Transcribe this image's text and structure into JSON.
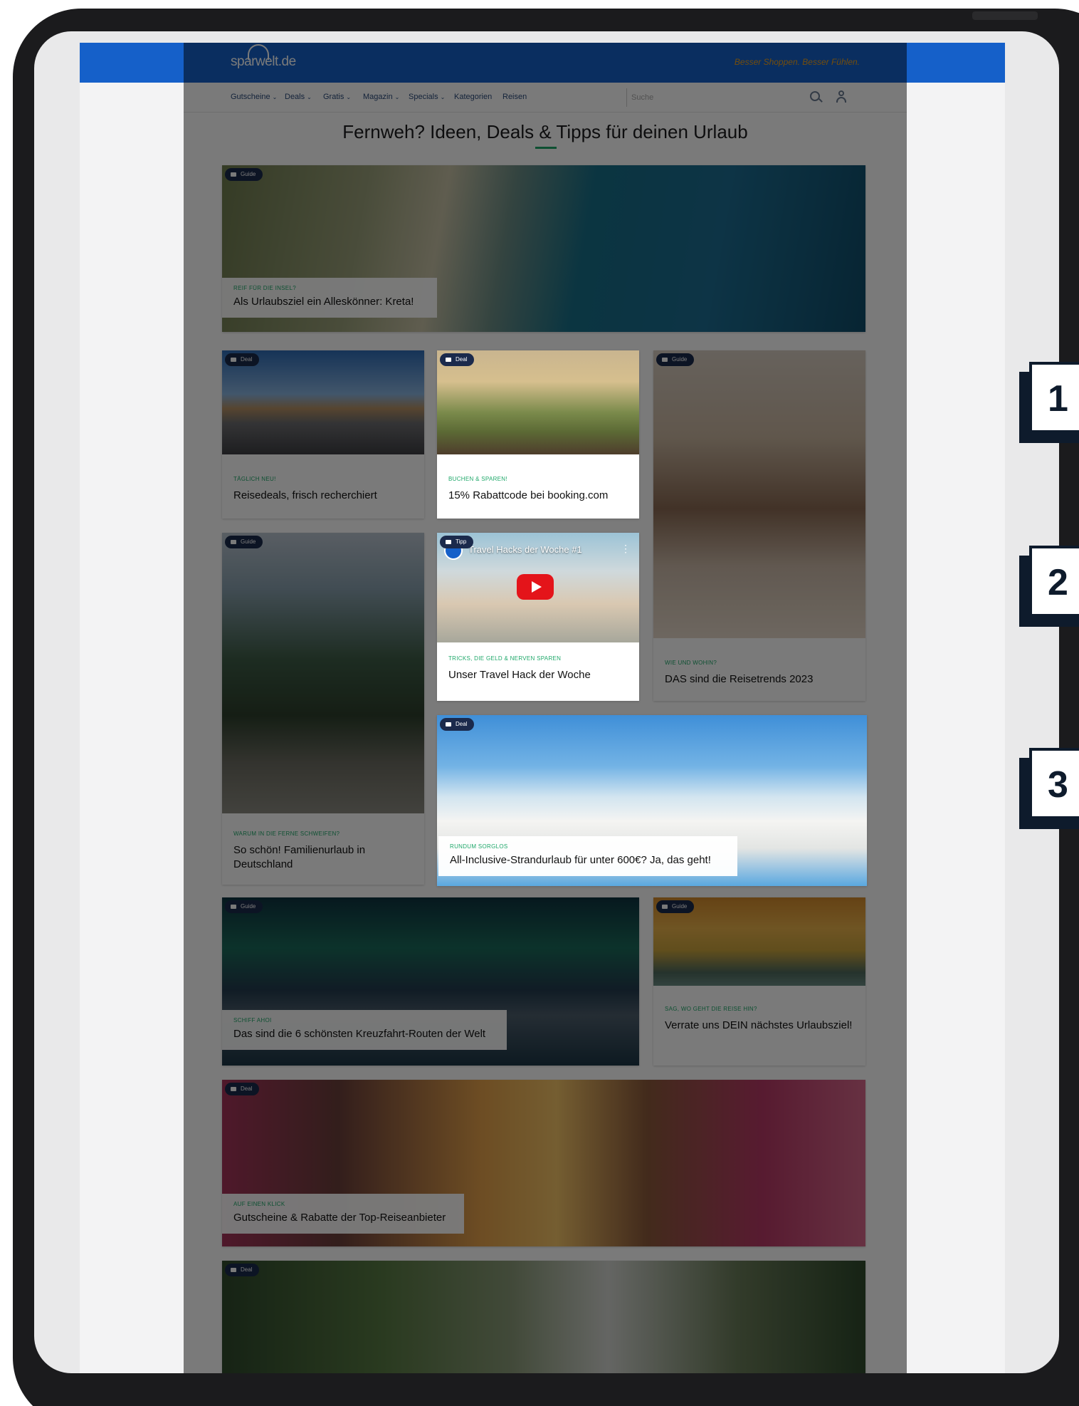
{
  "site": {
    "logo_text": "sparwelt.de",
    "slogan": "Besser Shoppen. Besser Fühlen.",
    "nav": [
      {
        "label": "Gutscheine",
        "caret": "⌄"
      },
      {
        "label": "Deals",
        "caret": "⌄"
      },
      {
        "label": "Gratis",
        "caret": "⌄"
      },
      {
        "label": "Magazin",
        "caret": "⌄"
      },
      {
        "label": "Specials",
        "caret": "⌄"
      },
      {
        "label": "Kategorien",
        "caret": ""
      },
      {
        "label": "Reisen",
        "caret": ""
      }
    ],
    "search_placeholder": "Suche"
  },
  "page_title": "Fernweh? Ideen, Deals & Tipps für deinen Urlaub",
  "cards": {
    "kreta": {
      "badge": "Guide",
      "tag": "REIF FÜR DIE INSEL?",
      "title": "Als Urlaubsziel ein Alleskönner: Kreta!"
    },
    "reisedeals": {
      "badge": "Deal",
      "tag": "TÄGLICH NEU!",
      "title": "Reisedeals, frisch recherchiert"
    },
    "booking": {
      "badge": "Deal",
      "tag": "BUCHEN & SPAREN!",
      "title": "15% Rabattcode bei booking.com"
    },
    "trends": {
      "badge": "Guide",
      "tag": "WIE UND WOHIN?",
      "title": "DAS sind die Reisetrends 2023"
    },
    "familie": {
      "badge": "Guide",
      "tag": "WARUM IN DIE FERNE SCHWEIFEN?",
      "title": "So schön! Familienurlaub in Deutschland"
    },
    "travelhack": {
      "badge": "Tipp",
      "tag": "TRICKS, DIE GELD & NERVEN SPAREN",
      "title": "Unser Travel Hack der Woche",
      "video_title": "Travel Hacks der Woche #1",
      "video_more": "⋮"
    },
    "strand": {
      "badge": "Deal",
      "tag": "RUNDUM SORGLOS",
      "title": "All-Inclusive-Strandurlaub für unter 600€? Ja, das geht!"
    },
    "kreuzfahrt": {
      "badge": "Guide",
      "tag": "SCHIFF AHOI",
      "title": "Das sind die 6 schönsten Kreuzfahrt-Routen der Welt"
    },
    "urlaubsziel": {
      "badge": "Guide",
      "tag": "SAG, WO GEHT DIE REISE HIN?",
      "title": "Verrate uns DEIN nächstes Urlaubsziel!"
    },
    "gutscheine": {
      "badge": "Deal",
      "tag": "AUF EINEN KLICK",
      "title": "Gutscheine & Rabatte der Top-Reiseanbieter"
    },
    "glamping": {
      "badge": "Deal"
    }
  },
  "steps": [
    "1",
    "2",
    "3"
  ],
  "colors": {
    "brand_blue": "#1560c9",
    "accent_green": "#1fa86a",
    "badge_navy": "#1b2a4c",
    "callout_navy": "#0e1b2c"
  }
}
